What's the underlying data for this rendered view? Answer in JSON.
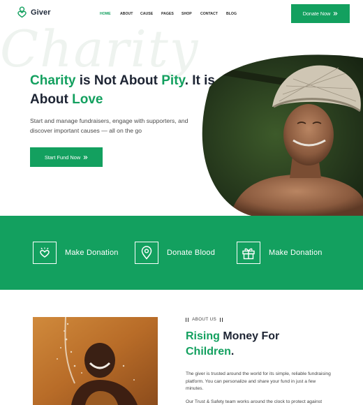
{
  "brand": {
    "name": "Giver",
    "accent": "#13a05f",
    "dark_text": "#1d2433"
  },
  "nav": {
    "items": [
      "HOME",
      "ABOUT",
      "CAUSE",
      "PAGES",
      "SHOP",
      "CONTACT",
      "BLOG"
    ],
    "active": "HOME"
  },
  "header": {
    "cta_label": "Donate Now",
    "cta_icon": "chevron-double-right-icon"
  },
  "hero": {
    "background_word": "Charity",
    "title_parts": [
      "Charity",
      " is Not About ",
      "Pity",
      ". It is About ",
      "Love"
    ],
    "description": "Start and manage fundraisers, engage with supporters, and discover important causes — all on the go",
    "button_label": "Start Fund Now",
    "button_icon": "chevron-double-right-icon",
    "image": "elderly-man-straw-hat-photo"
  },
  "features": [
    {
      "icon": "heart-hands-icon",
      "label": "Make Donation"
    },
    {
      "icon": "location-pin-icon",
      "label": "Donate Blood"
    },
    {
      "icon": "gift-box-icon",
      "label": "Make Donation"
    }
  ],
  "about": {
    "tag": "ABOUT US",
    "title_parts": [
      "Rising",
      " Money For ",
      "Children",
      "."
    ],
    "paragraph1": "The giver is trusted around the world for its simple, reliable fundraising platform. You can personalize and share your fund in just a few minutes.",
    "paragraph2": "Our Trust & Safety team works around the clock to protect against",
    "image": "child-playing-water-photo"
  }
}
